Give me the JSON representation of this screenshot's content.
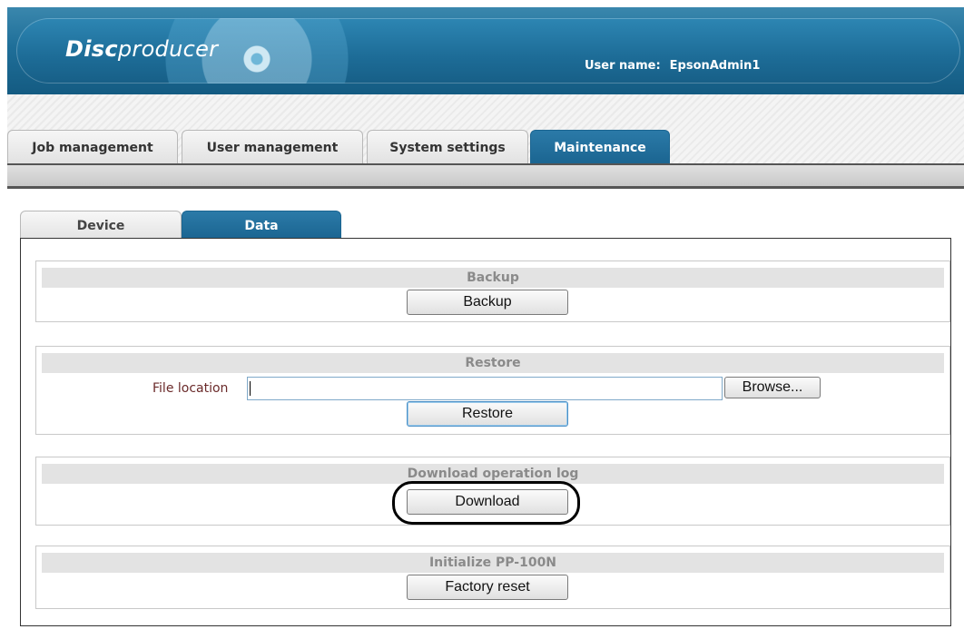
{
  "header": {
    "logo_part1": "Disc",
    "logo_part2": "producer",
    "user_label": "User name:",
    "user_value": "EpsonAdmin1"
  },
  "main_tabs": [
    {
      "label": "Job management",
      "active": false
    },
    {
      "label": "User management",
      "active": false
    },
    {
      "label": "System settings",
      "active": false
    },
    {
      "label": "Maintenance",
      "active": true
    }
  ],
  "sub_tabs": [
    {
      "label": "Device",
      "active": false
    },
    {
      "label": "Data",
      "active": true
    }
  ],
  "sections": {
    "backup": {
      "title": "Backup",
      "button": "Backup"
    },
    "restore": {
      "title": "Restore",
      "file_label": "File location",
      "file_value": "",
      "browse": "Browse...",
      "button": "Restore"
    },
    "download": {
      "title": "Download operation log",
      "button": "Download"
    },
    "initialize": {
      "title": "Initialize PP-100N",
      "button": "Factory reset"
    }
  },
  "colors": {
    "header_blue": "#1f6f99",
    "tab_active": "#1b6591",
    "section_head_bg": "#e3e3e3",
    "section_head_text": "#8a8a8a"
  },
  "icons": [
    "disc-icon"
  ]
}
